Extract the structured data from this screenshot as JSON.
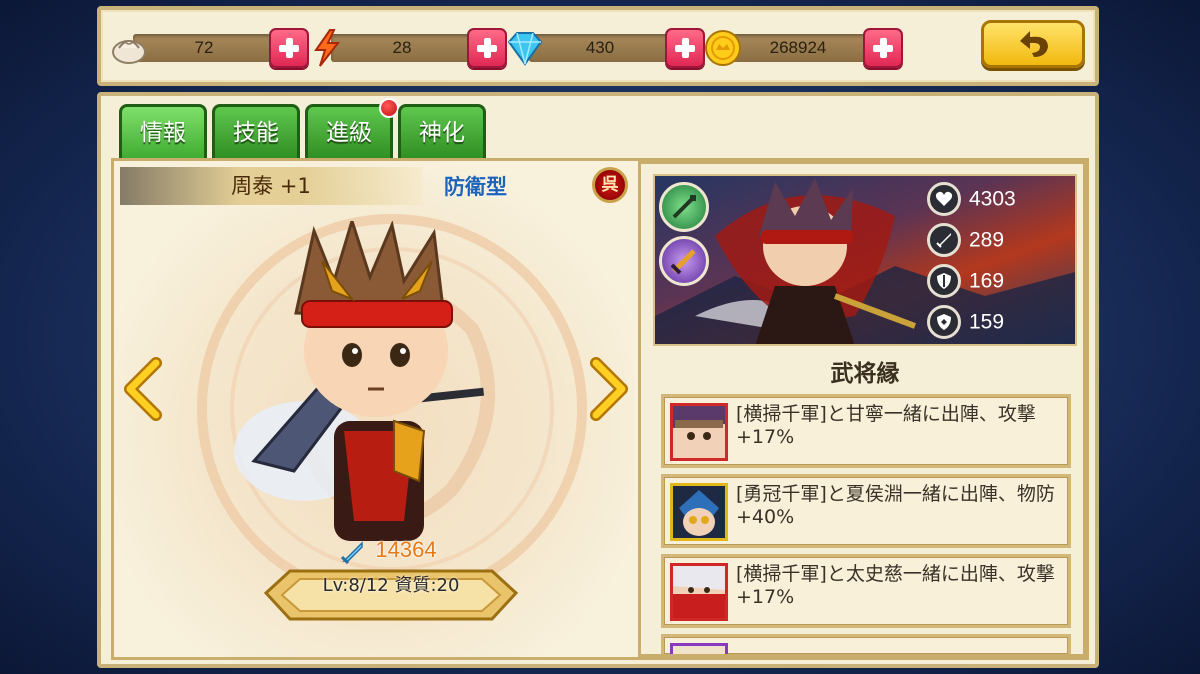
{
  "resources": [
    {
      "name": "bun",
      "icon": "steamed-bun-icon",
      "value": "72"
    },
    {
      "name": "energy",
      "icon": "lightning-icon",
      "value": "28"
    },
    {
      "name": "gems",
      "icon": "diamond-icon",
      "value": "430"
    },
    {
      "name": "gold",
      "icon": "gold-coin-icon",
      "value": "268924"
    }
  ],
  "tabs": [
    {
      "label": "情報",
      "active": true
    },
    {
      "label": "技能",
      "active": false
    },
    {
      "label": "進級",
      "active": false,
      "notification": true
    },
    {
      "label": "神化",
      "active": false
    }
  ],
  "hero": {
    "name": "周泰 +1",
    "type": "防衛型",
    "faction": "呉",
    "power": "14364",
    "level_info": "Lv:8/12 資質:20"
  },
  "stats": [
    {
      "icon": "heart-icon",
      "value": "4303"
    },
    {
      "icon": "sword-icon",
      "value": "289"
    },
    {
      "icon": "shield-icon",
      "value": "169"
    },
    {
      "icon": "magic-shield-icon",
      "value": "159"
    }
  ],
  "fate_title": "武将縁",
  "fates": [
    {
      "text": "[横掃千軍]と甘寧一緒に出陣、攻撃+17%",
      "avatar": "gan-ning-avatar"
    },
    {
      "text": "[勇冠千軍]と夏侯淵一緒に出陣、物防+40%",
      "avatar": "xiahou-yuan-avatar"
    },
    {
      "text": "[横掃千軍]と太史慈一緒に出陣、攻撃+17%",
      "avatar": "taishi-ci-avatar"
    }
  ],
  "colors": {
    "tab_green": "#3ea930",
    "plus_red": "#e02855",
    "button_gold": "#f1b90e",
    "type_blue": "#1f63b8",
    "power_orange": "#e87a15"
  }
}
